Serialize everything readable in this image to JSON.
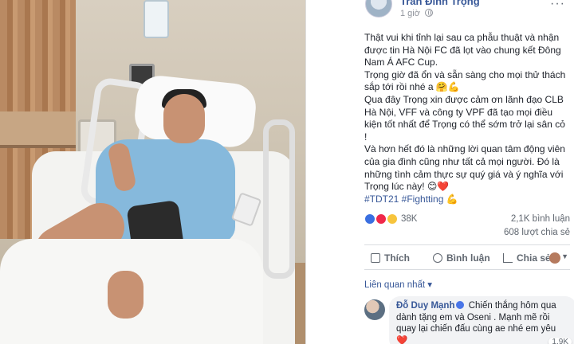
{
  "post": {
    "author": "Trần Đình Trọng",
    "time": "1 giờ",
    "more": "···",
    "paragraphs": [
      "Thật vui khi tỉnh lại sau ca phẫu thuật và nhận được tin Hà Nội FC đã lọt vào chung kết Đông Nam Á AFC Cup.",
      "Trọng giờ đã ổn và sẵn sàng cho mọi thử thách sắp tới rồi nhé a 🤗💪",
      "Qua đây Trọng xin được cảm ơn lãnh đạo CLB Hà Nội, VFF và công ty VPF đã tạo mọi điều kiện tốt nhất để Trọng có thể sớm trở lại sân cỏ !",
      "Và hơn hết đó là những lời quan tâm động viên của gia đình cũng như tất cả mọi người. Đó là những tình cảm thực sự quý giá và ý nghĩa với Trọng lúc này! 😊❤️"
    ],
    "hashtags": "#TDT21 #Fightting 💪",
    "reaction_count": "38K",
    "comment_count": "2,1K bình luận",
    "share_count": "608 lượt chia sẻ",
    "actions": {
      "like": "Thích",
      "comment": "Bình luận",
      "share": "Chia sẻ"
    },
    "related_label": "Liên quan nhất ▾"
  },
  "comment": {
    "name": "Đỗ Duy Mạnh",
    "text": "Chiến thắng hôm qua dành tặng em và Oseni . Mạnh mẽ rồi quay lại chiến đấu cùng ae nhé em yêu ❤️",
    "reactions": "1,9K"
  },
  "colors": {
    "link": "#385898",
    "text": "#1d2129",
    "muted": "#606770"
  },
  "icons": [
    "globe-icon",
    "like-icon",
    "comment-icon",
    "share-icon",
    "verified-icon"
  ]
}
